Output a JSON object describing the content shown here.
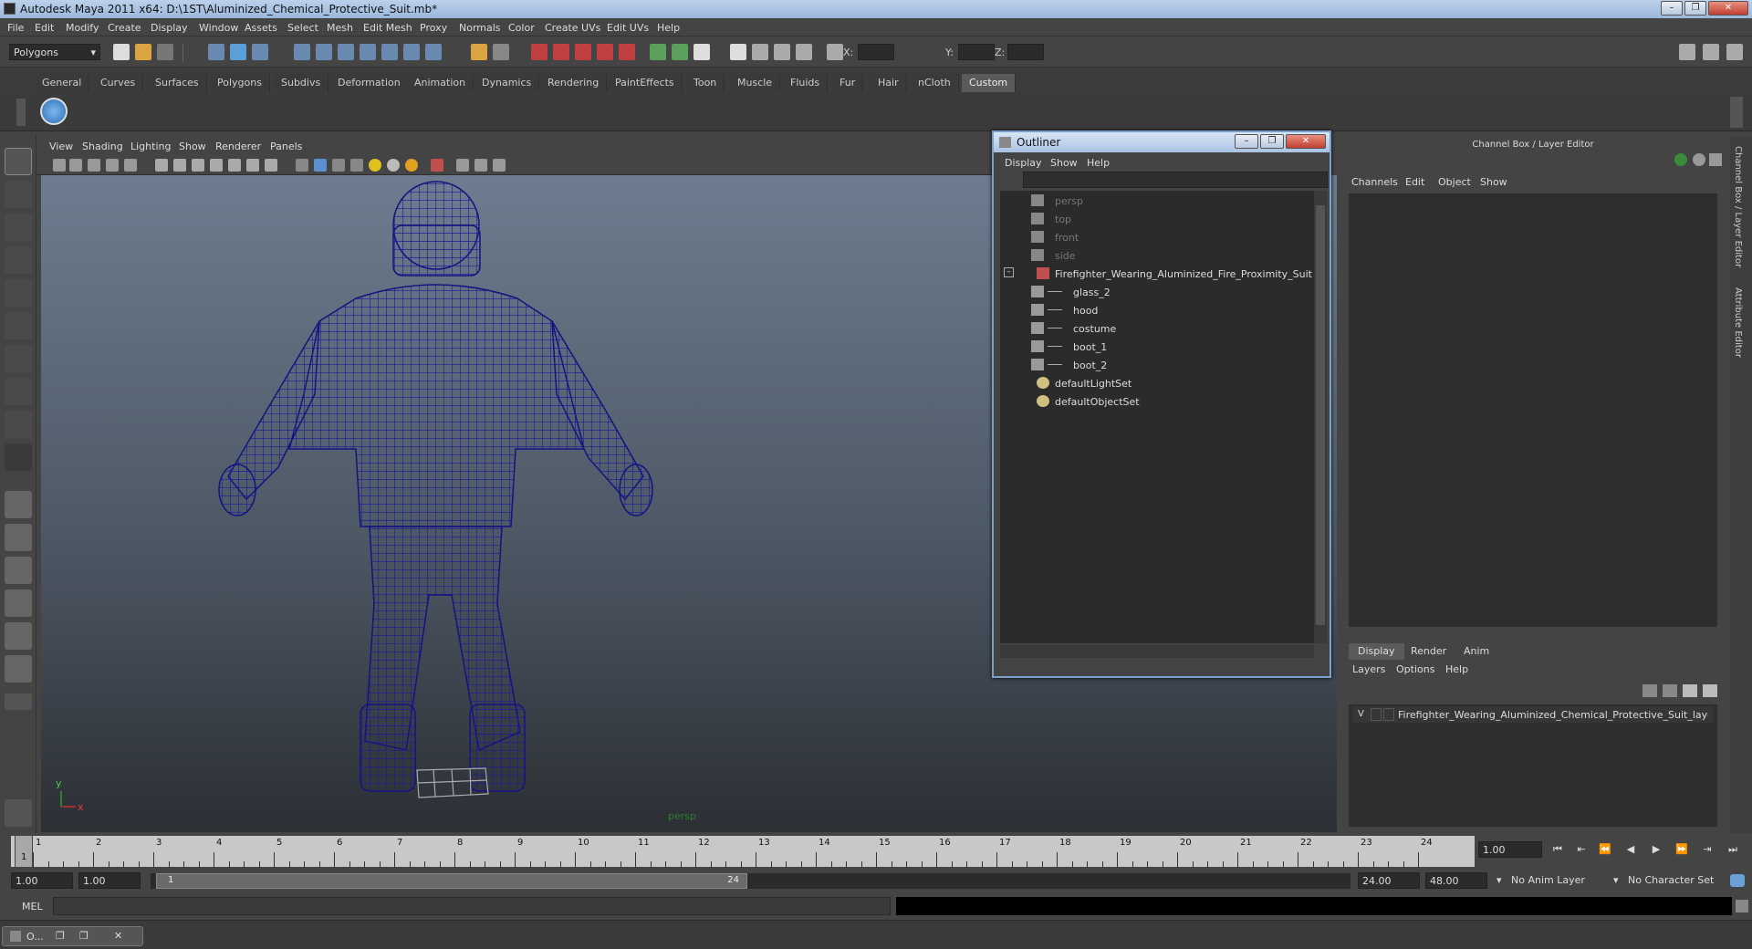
{
  "window": {
    "title": "Autodesk Maya 2011 x64: D:\\1ST\\Aluminized_Chemical_Protective_Suit.mb*",
    "min": "–",
    "max": "❐",
    "close": "✕"
  },
  "menubar": [
    "File",
    "Edit",
    "Modify",
    "Create",
    "Display",
    "Window",
    "Assets",
    "Select",
    "Mesh",
    "Edit Mesh",
    "Proxy",
    "Normals",
    "Color",
    "Create UVs",
    "Edit UVs",
    "Help"
  ],
  "statusline": {
    "mode": "Polygons",
    "x_label": "X:",
    "y_label": "Y:",
    "z_label": "Z:"
  },
  "shelf_tabs": [
    "General",
    "Curves",
    "Surfaces",
    "Polygons",
    "Subdivs",
    "Deformation",
    "Animation",
    "Dynamics",
    "Rendering",
    "PaintEffects",
    "Toon",
    "Muscle",
    "Fluids",
    "Fur",
    "Hair",
    "nCloth",
    "Custom"
  ],
  "shelf_active": "Custom",
  "viewport": {
    "menu": [
      "View",
      "Shading",
      "Lighting",
      "Show",
      "Renderer",
      "Panels"
    ],
    "camera_label": "persp",
    "axis_y": "y",
    "axis_x": "x"
  },
  "outliner": {
    "title": "Outliner",
    "menu": [
      "Display",
      "Show",
      "Help"
    ],
    "items": [
      {
        "label": "persp",
        "dim": true
      },
      {
        "label": "top",
        "dim": true
      },
      {
        "label": "front",
        "dim": true
      },
      {
        "label": "side",
        "dim": true
      },
      {
        "label": "Firefighter_Wearing_Aluminized_Fire_Proximity_Suit",
        "dim": false
      },
      {
        "label": "glass_2",
        "dim": false
      },
      {
        "label": "hood",
        "dim": false
      },
      {
        "label": "costume",
        "dim": false
      },
      {
        "label": "boot_1",
        "dim": false
      },
      {
        "label": "boot_2",
        "dim": false
      },
      {
        "label": "defaultLightSet",
        "dim": false
      },
      {
        "label": "defaultObjectSet",
        "dim": false
      }
    ],
    "expand_symbol": "–"
  },
  "channelbox": {
    "title": "Channel Box / Layer Editor",
    "menu": [
      "Channels",
      "Edit",
      "Object",
      "Show"
    ],
    "layer_tabs": [
      "Display",
      "Render",
      "Anim"
    ],
    "layer_active": "Display",
    "layer_menu": [
      "Layers",
      "Options",
      "Help"
    ],
    "layer_name": "Firefighter_Wearing_Aluminized_Chemical_Protective_Suit_laye",
    "layer_v": "V",
    "side_tabs": [
      "Channel Box / Layer Editor",
      "Attribute Editor"
    ]
  },
  "timeline": {
    "ticks": [
      "1",
      "2",
      "3",
      "4",
      "5",
      "6",
      "7",
      "8",
      "9",
      "10",
      "11",
      "12",
      "13",
      "14",
      "15",
      "16",
      "17",
      "18",
      "19",
      "20",
      "21",
      "22",
      "23",
      "24"
    ],
    "current_marker": "1",
    "current_frame": "1.00"
  },
  "range": {
    "start": "1.00",
    "playback_start": "1.00",
    "handle_start": "1",
    "handle_end": "24",
    "playback_end": "24.00",
    "end": "48.00",
    "anim_layer": "No Anim Layer",
    "character_set": "No Character Set"
  },
  "cmdline": {
    "label": "MEL"
  },
  "taskbar": {
    "item": "O..."
  }
}
